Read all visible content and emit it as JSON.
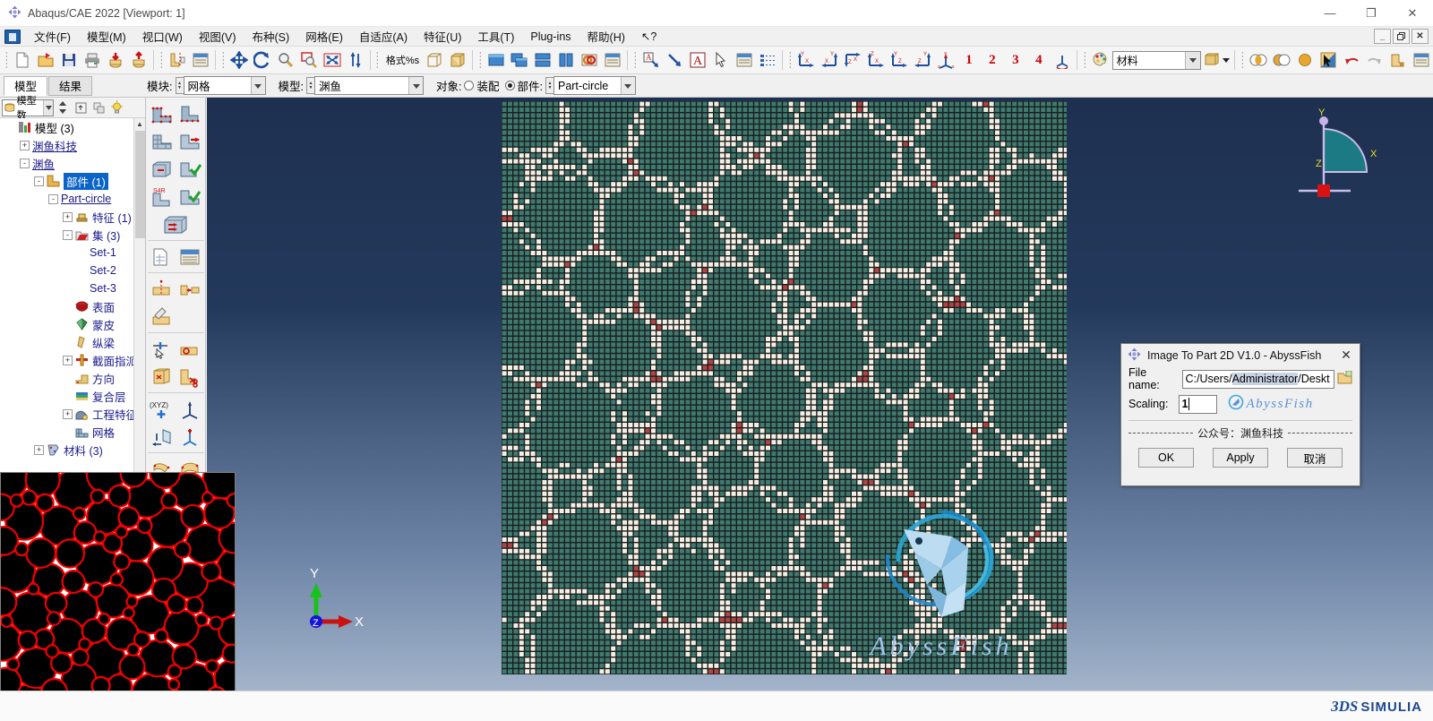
{
  "window": {
    "title": "Abaqus/CAE 2022 [Viewport: 1]",
    "app_icon": "abaqus-icon",
    "minimize": "—",
    "maximize": "❐",
    "close": "✕",
    "mdi_minimize": "_",
    "mdi_restore": "❐",
    "mdi_close": "✕"
  },
  "menubar": {
    "items": [
      {
        "label": "文件(F)",
        "name": "menu-file"
      },
      {
        "label": "模型(M)",
        "name": "menu-model"
      },
      {
        "label": "视口(W)",
        "name": "menu-viewport"
      },
      {
        "label": "视图(V)",
        "name": "menu-view"
      },
      {
        "label": "布种(S)",
        "name": "menu-seed"
      },
      {
        "label": "网格(E)",
        "name": "menu-mesh"
      },
      {
        "label": "自适应(A)",
        "name": "menu-adaptivity"
      },
      {
        "label": "特征(U)",
        "name": "menu-feature"
      },
      {
        "label": "工具(T)",
        "name": "menu-tools"
      },
      {
        "label": "Plug-ins",
        "name": "menu-plugins"
      },
      {
        "label": "帮助(H)",
        "name": "menu-help"
      },
      {
        "label": "↖?",
        "name": "menu-whats-this"
      }
    ]
  },
  "toolbar": {
    "format_label": "格式%s",
    "numbers": [
      "1",
      "2",
      "3",
      "4"
    ],
    "material_value": "材料",
    "material_placeholder": "材料"
  },
  "contextbar": {
    "tabs": [
      {
        "label": "模型",
        "active": true
      },
      {
        "label": "结果",
        "active": false
      }
    ],
    "module_label": "模块:",
    "module_value": "网格",
    "model_label": "模型:",
    "model_value": "渊鱼",
    "object_label": "对象:",
    "assembly_label": "装配",
    "part_label": "部件:",
    "part_value": "Part-circle",
    "object_selected": "part"
  },
  "tree": {
    "selector_value": "模型数",
    "nodes": [
      {
        "indent": 0,
        "exp": "",
        "icon": "model-db-icon",
        "label": "模型 (3)",
        "style": "black",
        "name": "tree-models-root"
      },
      {
        "indent": 1,
        "exp": "+",
        "icon": "",
        "label": "渊鱼科技",
        "style": "ul",
        "name": "tree-model-abyssfish-tech"
      },
      {
        "indent": 1,
        "exp": "-",
        "icon": "",
        "label": "渊鱼",
        "style": "ul",
        "name": "tree-model-abyssfish"
      },
      {
        "indent": 2,
        "exp": "-",
        "icon": "parts-icon",
        "label": "部件 (1)",
        "style": "sel",
        "name": "tree-parts"
      },
      {
        "indent": 3,
        "exp": "-",
        "icon": "",
        "label": "Part-circle",
        "style": "ul",
        "name": "tree-part-circle"
      },
      {
        "indent": 4,
        "exp": "+",
        "icon": "feature-icon",
        "label": "特征 (1)",
        "style": "",
        "name": "tree-features"
      },
      {
        "indent": 4,
        "exp": "-",
        "icon": "sets-icon",
        "label": "集 (3)",
        "style": "",
        "name": "tree-sets"
      },
      {
        "indent": 5,
        "exp": "",
        "icon": "",
        "label": "Set-1",
        "style": "",
        "name": "tree-set-1"
      },
      {
        "indent": 5,
        "exp": "",
        "icon": "",
        "label": "Set-2",
        "style": "",
        "name": "tree-set-2"
      },
      {
        "indent": 5,
        "exp": "",
        "icon": "",
        "label": "Set-3",
        "style": "",
        "name": "tree-set-3"
      },
      {
        "indent": 4,
        "exp": "",
        "icon": "surface-icon",
        "label": "表面",
        "style": "",
        "name": "tree-surfaces"
      },
      {
        "indent": 4,
        "exp": "",
        "icon": "skin-icon",
        "label": "蒙皮",
        "style": "",
        "name": "tree-skins"
      },
      {
        "indent": 4,
        "exp": "",
        "icon": "stringer-icon",
        "label": "纵梁",
        "style": "",
        "name": "tree-stringers"
      },
      {
        "indent": 4,
        "exp": "+",
        "icon": "section-assign-icon",
        "label": "截面指派",
        "style": "",
        "name": "tree-section-assignments"
      },
      {
        "indent": 4,
        "exp": "",
        "icon": "orientation-icon",
        "label": "方向",
        "style": "",
        "name": "tree-orientations"
      },
      {
        "indent": 4,
        "exp": "",
        "icon": "composite-icon",
        "label": "复合层",
        "style": "",
        "name": "tree-composite-layups"
      },
      {
        "indent": 4,
        "exp": "+",
        "icon": "engineering-icon",
        "label": "工程特征",
        "style": "",
        "name": "tree-engineering-features"
      },
      {
        "indent": 4,
        "exp": "",
        "icon": "mesh-icon",
        "label": "网格",
        "style": "",
        "name": "tree-mesh"
      },
      {
        "indent": 2,
        "exp": "+",
        "icon": "materials-icon",
        "label": "材料 (3)",
        "style": "",
        "name": "tree-materials"
      }
    ]
  },
  "dialog": {
    "title": "Image To Part 2D V1.0 - AbyssFish",
    "icon": "abaqus-plugin-icon",
    "close_label": "✕",
    "file_label": "File name:",
    "file_value_plain": "C:/Users/",
    "file_value_selected": "Administrator",
    "file_value_tail": "/Deskt",
    "browse_icon": "folder-browse-icon",
    "scaling_label": "Scaling:",
    "scaling_value": "1",
    "brand": "AbyssFish",
    "brand_icon": "abyssfish-circle-icon",
    "footer_text": "公众号：渊鱼科技",
    "ok_label": "OK",
    "apply_label": "Apply",
    "cancel_label": "取消"
  },
  "viewport": {
    "watermark_text": "AbyssFish",
    "triad": {
      "x": "X",
      "y": "Y",
      "z": "Z"
    },
    "viewcube": {
      "y": "Y",
      "z": "Z",
      "x": "X"
    },
    "mesh_colors": {
      "inclusion": "#3d7a70",
      "matrix": "#b04444",
      "boundary": "#f2f0e4",
      "edge": "#1d1d1d",
      "background_top": "#1e3050",
      "background_bottom": "#a3b4ca"
    }
  },
  "preview": {
    "circle_fill": "#000000",
    "circle_outline": "#ee0000",
    "background": "#ffffff"
  },
  "branding": {
    "ds_mark": "3DS",
    "simulia": "SIMULIA"
  }
}
